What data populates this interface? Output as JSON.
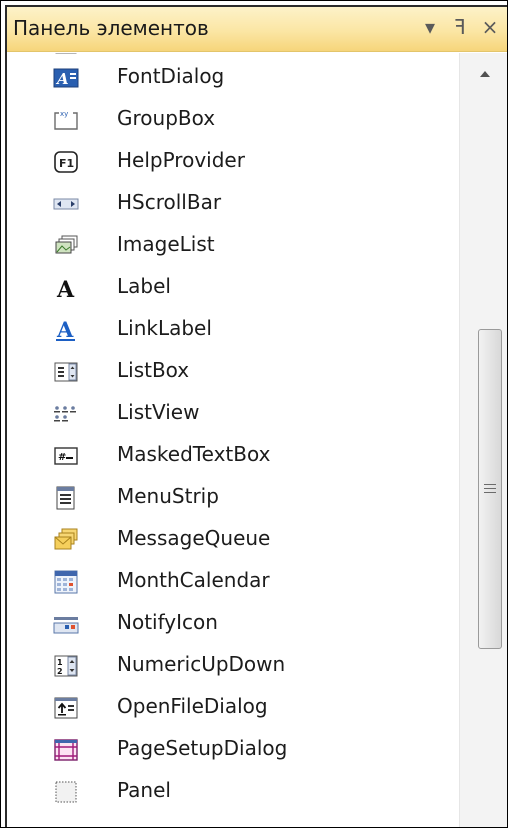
{
  "panel": {
    "title": "Панель элементов",
    "buttons": {
      "dropdown": "▾",
      "pin": "ꟻ",
      "close": "×"
    }
  },
  "items": [
    {
      "label": "FontDialog",
      "icon": "font-dialog-icon"
    },
    {
      "label": "GroupBox",
      "icon": "groupbox-icon"
    },
    {
      "label": "HelpProvider",
      "icon": "help-provider-icon"
    },
    {
      "label": "HScrollBar",
      "icon": "hscrollbar-icon"
    },
    {
      "label": "ImageList",
      "icon": "imagelist-icon"
    },
    {
      "label": "Label",
      "icon": "label-icon"
    },
    {
      "label": "LinkLabel",
      "icon": "linklabel-icon"
    },
    {
      "label": "ListBox",
      "icon": "listbox-icon"
    },
    {
      "label": "ListView",
      "icon": "listview-icon"
    },
    {
      "label": "MaskedTextBox",
      "icon": "maskedtextbox-icon"
    },
    {
      "label": "MenuStrip",
      "icon": "menustrip-icon"
    },
    {
      "label": "MessageQueue",
      "icon": "messagequeue-icon"
    },
    {
      "label": "MonthCalendar",
      "icon": "monthcalendar-icon"
    },
    {
      "label": "NotifyIcon",
      "icon": "notifyicon-icon"
    },
    {
      "label": "NumericUpDown",
      "icon": "numericupdown-icon"
    },
    {
      "label": "OpenFileDialog",
      "icon": "openfiledialog-icon"
    },
    {
      "label": "PageSetupDialog",
      "icon": "pagesetupdialog-icon"
    },
    {
      "label": "Panel",
      "icon": "panel-icon"
    }
  ],
  "colors": {
    "title_bar": "#fbe6a4",
    "icon_blue": "#2a5fb0",
    "link_blue": "#1c5fc4"
  }
}
